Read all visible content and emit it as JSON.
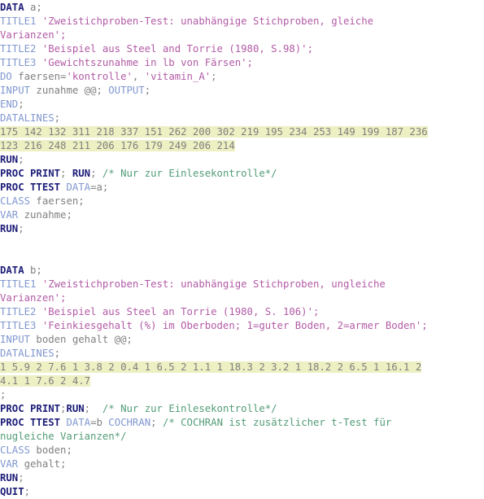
{
  "editor": {
    "name": "sas-code-editor",
    "language": "SAS",
    "background": "#ffffff",
    "colors": {
      "statement_keyword": "#1c1c78",
      "secondary_keyword": "#8097cf",
      "string": "#b25ba6",
      "comment": "#539c78",
      "identifier": "#808080",
      "datalines_highlight": "#edf0c2"
    }
  },
  "lines": [
    {
      "n": 1,
      "segments": [
        {
          "t": "DATA",
          "c": "kw-stmt"
        },
        {
          "t": " a;",
          "c": "ident"
        }
      ]
    },
    {
      "n": 2,
      "segments": [
        {
          "t": "TITLE1",
          "c": "kw-sec"
        },
        {
          "t": " ",
          "c": "ident"
        },
        {
          "t": "'Zweistichproben-Test: unabhängige Stichproben, gleiche",
          "c": "str"
        }
      ]
    },
    {
      "n": 3,
      "segments": [
        {
          "t": "Varianzen';",
          "c": "str"
        }
      ]
    },
    {
      "n": 4,
      "segments": [
        {
          "t": "TITLE2",
          "c": "kw-sec"
        },
        {
          "t": " ",
          "c": "ident"
        },
        {
          "t": "'Beispiel aus Steel and Torrie (1980, S.98)';",
          "c": "str"
        }
      ]
    },
    {
      "n": 5,
      "segments": [
        {
          "t": "TITLE3",
          "c": "kw-sec"
        },
        {
          "t": " ",
          "c": "ident"
        },
        {
          "t": "'Gewichtszunahme in lb von Färsen';",
          "c": "str"
        }
      ]
    },
    {
      "n": 6,
      "segments": [
        {
          "t": "DO",
          "c": "kw-sec"
        },
        {
          "t": " faersen=",
          "c": "ident"
        },
        {
          "t": "'kontrolle'",
          "c": "str"
        },
        {
          "t": ", ",
          "c": "ident"
        },
        {
          "t": "'vitamin_A'",
          "c": "str"
        },
        {
          "t": ";",
          "c": "ident"
        }
      ]
    },
    {
      "n": 7,
      "segments": [
        {
          "t": "INPUT",
          "c": "kw-sec"
        },
        {
          "t": " zunahme @@; ",
          "c": "ident"
        },
        {
          "t": "OUTPUT",
          "c": "kw-sec"
        },
        {
          "t": ";",
          "c": "ident"
        }
      ]
    },
    {
      "n": 8,
      "segments": [
        {
          "t": "END",
          "c": "kw-sec"
        },
        {
          "t": ";",
          "c": "ident"
        }
      ]
    },
    {
      "n": 9,
      "segments": [
        {
          "t": "DATALINES",
          "c": "kw-sec"
        },
        {
          "t": ";",
          "c": "ident"
        }
      ]
    },
    {
      "n": 10,
      "segments": [
        {
          "t": "175 142 132 311 218 337 151 262 200 302 219 195 234 253 149 199 187 236",
          "c": "data"
        }
      ]
    },
    {
      "n": 11,
      "segments": [
        {
          "t": "123 216 248 211 206 176 179 249 206 214",
          "c": "data"
        }
      ]
    },
    {
      "n": 12,
      "segments": [
        {
          "t": "RUN",
          "c": "kw-stmt"
        },
        {
          "t": ";",
          "c": "ident"
        }
      ]
    },
    {
      "n": 13,
      "segments": [
        {
          "t": "PROC PRINT",
          "c": "kw-stmt"
        },
        {
          "t": "; ",
          "c": "ident"
        },
        {
          "t": "RUN",
          "c": "kw-stmt"
        },
        {
          "t": "; ",
          "c": "ident"
        },
        {
          "t": "/* Nur zur Einlesekontrolle*/",
          "c": "cmt"
        }
      ]
    },
    {
      "n": 14,
      "segments": [
        {
          "t": "PROC TTEST",
          "c": "kw-stmt"
        },
        {
          "t": " ",
          "c": "ident"
        },
        {
          "t": "DATA",
          "c": "kw-sec"
        },
        {
          "t": "=a;",
          "c": "ident"
        }
      ]
    },
    {
      "n": 15,
      "segments": [
        {
          "t": "CLASS",
          "c": "kw-sec"
        },
        {
          "t": " faersen;",
          "c": "ident"
        }
      ]
    },
    {
      "n": 16,
      "segments": [
        {
          "t": "VAR",
          "c": "kw-sec"
        },
        {
          "t": " zunahme;",
          "c": "ident"
        }
      ]
    },
    {
      "n": 17,
      "segments": [
        {
          "t": "RUN",
          "c": "kw-stmt"
        },
        {
          "t": ";",
          "c": "ident"
        }
      ]
    },
    {
      "n": 18,
      "segments": []
    },
    {
      "n": 19,
      "segments": []
    },
    {
      "n": 20,
      "segments": [
        {
          "t": "DATA",
          "c": "kw-stmt"
        },
        {
          "t": " b;",
          "c": "ident"
        }
      ]
    },
    {
      "n": 21,
      "segments": [
        {
          "t": "TITLE1",
          "c": "kw-sec"
        },
        {
          "t": " ",
          "c": "ident"
        },
        {
          "t": "'Zweistichproben-Test: unabhängige Stichproben, ungleiche",
          "c": "str"
        }
      ]
    },
    {
      "n": 22,
      "segments": [
        {
          "t": "Varianzen';",
          "c": "str"
        }
      ]
    },
    {
      "n": 23,
      "segments": [
        {
          "t": "TITLE2",
          "c": "kw-sec"
        },
        {
          "t": " ",
          "c": "ident"
        },
        {
          "t": "'Beispiel aus Steel an Torrie (1980, S. 106)';",
          "c": "str"
        }
      ]
    },
    {
      "n": 24,
      "segments": [
        {
          "t": "TITLE3",
          "c": "kw-sec"
        },
        {
          "t": " ",
          "c": "ident"
        },
        {
          "t": "'Feinkiesgehalt (%) im Oberboden; 1=guter Boden, 2=armer Boden';",
          "c": "str"
        }
      ]
    },
    {
      "n": 25,
      "segments": [
        {
          "t": "INPUT",
          "c": "kw-sec"
        },
        {
          "t": " boden gehalt @@;",
          "c": "ident"
        }
      ]
    },
    {
      "n": 26,
      "segments": [
        {
          "t": "DATALINES",
          "c": "kw-sec"
        },
        {
          "t": ";",
          "c": "ident"
        }
      ]
    },
    {
      "n": 27,
      "segments": [
        {
          "t": "1 5.9 2 7.6 1 3.8 2 0.4 1 6.5 2 1.1 1 18.3 2 3.2 1 18.2 2 6.5 1 16.1 2",
          "c": "data"
        }
      ]
    },
    {
      "n": 28,
      "segments": [
        {
          "t": "4.1 1 7.6 2 4.7",
          "c": "data"
        }
      ]
    },
    {
      "n": 29,
      "segments": [
        {
          "t": ";",
          "c": "ident"
        }
      ]
    },
    {
      "n": 30,
      "segments": [
        {
          "t": "PROC PRINT",
          "c": "kw-stmt"
        },
        {
          "t": ";",
          "c": "ident"
        },
        {
          "t": "RUN",
          "c": "kw-stmt"
        },
        {
          "t": ";  ",
          "c": "ident"
        },
        {
          "t": "/* Nur zur Einlesekontrolle*/",
          "c": "cmt"
        }
      ]
    },
    {
      "n": 31,
      "segments": [
        {
          "t": "PROC TTEST",
          "c": "kw-stmt"
        },
        {
          "t": " ",
          "c": "ident"
        },
        {
          "t": "DATA",
          "c": "kw-sec"
        },
        {
          "t": "=b ",
          "c": "ident"
        },
        {
          "t": "COCHRAN",
          "c": "kw-sec"
        },
        {
          "t": "; ",
          "c": "ident"
        },
        {
          "t": "/* COCHRAN ist zusätzlicher t-Test für",
          "c": "cmt"
        }
      ]
    },
    {
      "n": 32,
      "segments": [
        {
          "t": "nugleiche Varianzen*/",
          "c": "cmt"
        }
      ]
    },
    {
      "n": 33,
      "segments": [
        {
          "t": "CLASS",
          "c": "kw-sec"
        },
        {
          "t": " boden;",
          "c": "ident"
        }
      ]
    },
    {
      "n": 34,
      "segments": [
        {
          "t": "VAR",
          "c": "kw-sec"
        },
        {
          "t": " gehalt;",
          "c": "ident"
        }
      ]
    },
    {
      "n": 35,
      "segments": [
        {
          "t": "RUN",
          "c": "kw-stmt"
        },
        {
          "t": ";",
          "c": "ident"
        }
      ]
    },
    {
      "n": 36,
      "segments": [
        {
          "t": "QUIT",
          "c": "kw-stmt"
        },
        {
          "t": ";",
          "c": "ident"
        }
      ]
    }
  ]
}
